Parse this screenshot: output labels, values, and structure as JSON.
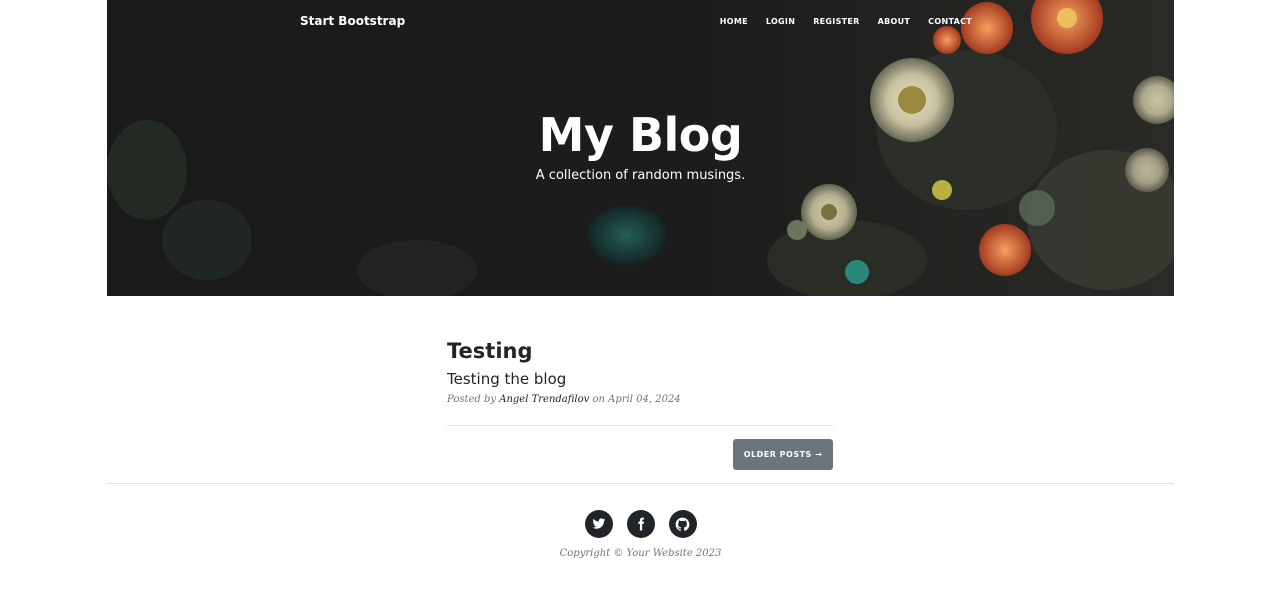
{
  "navbar": {
    "brand": "Start Bootstrap",
    "links": [
      "HOME",
      "LOGIN",
      "REGISTER",
      "ABOUT",
      "CONTACT"
    ]
  },
  "hero": {
    "title": "My Blog",
    "subtitle": "A collection of random musings."
  },
  "posts": [
    {
      "title": "Testing",
      "subtitle": "Testing the blog",
      "meta_prefix": "Posted by",
      "author": "Angel Trendafilov",
      "meta_middle": "on",
      "date": "April 04, 2024"
    }
  ],
  "pager": {
    "older_label": "Older Posts →"
  },
  "footer": {
    "social_icons": [
      "twitter-icon",
      "facebook-icon",
      "github-icon"
    ],
    "copyright": "Copyright © Your Website 2023"
  },
  "colors": {
    "hero_dark": "#1d1d1d",
    "text_dark": "#212529",
    "muted": "#6c757d",
    "button": "#6c757d"
  }
}
